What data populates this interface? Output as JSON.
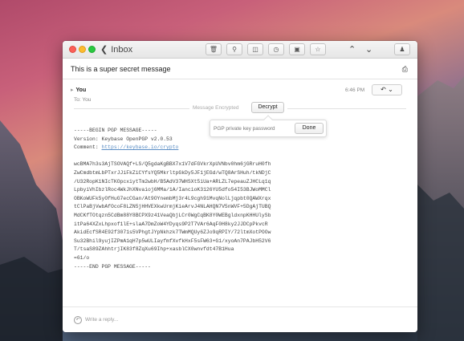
{
  "toolbar": {
    "back_label": "Inbox",
    "buttons": [
      "trash-icon",
      "tag-icon",
      "archive-icon",
      "clock-icon",
      "move-icon",
      "star-icon"
    ]
  },
  "message": {
    "subject": "This is a super secret message",
    "sender": "You",
    "to": "To: You",
    "time": "6:46 PM"
  },
  "encryption": {
    "status_label": "Message Encrypted",
    "decrypt_label": "Decrypt",
    "password_placeholder": "PGP private key password",
    "done_label": "Done"
  },
  "pgp": {
    "begin": "-----BEGIN PGP MESSAGE-----",
    "version": "Version: Keybase OpenPGP v2.0.53",
    "comment_prefix": "Comment: ",
    "comment_link": "https://keybase.io/crypto",
    "lines": [
      "wcBMA7h3s3AjTSOVAQf+LS/Q5gdaKgBBX7x1V7dFGVkrXpUVNbv0hm6jGRruH0fh",
      "ZwCmdbtmLbPTxrJJiFkZiCYfsYQ5MkrltpGkDy5JF1jEGd/wTQ8ArSHuh/tkNDjC",
      "/U32RopK1NIcTKOpcxiytTm2wbH/B5AdV37WHSXt5iUa+ARLZL7epeauZJHCLq1q",
      "LpbyiVhIbzlRoc4WkJhXNvaioj6MMa/1A/IancioK3126YU5dfo54I53BJWoMMCl",
      "OBKoWUFk5yOfHuG7ecCGan/At9OYnembMj3r4L9cgh91MvqNolLjqpbt0QAWXrqx",
      "tClPaBjVwbAfOcoF8LZN5jHHVEXkwUrmjKieArvJ4NLAHQN7V5nWVF+5DgAjTUBQ",
      "MdCKfTOtqzn5CdBm88Y8BCPX9z41VeaQbjLCr0WgCqBK8Y0WEBgldxnpKHHUlySb",
      "itPa64XZxLhpxof1lE+slaA7DmZoW4YDyqs9P2T7VAr6AqF0H8ky2JJDCpPkvcR",
      "AkidEcfSR4E92f3071s5VPhgtJYpNkhzk7TWmMQUy6ZJo9qRPIY/72ltmXotPOOw",
      "Su32Bhil9yujIZPmA1qH7p5wULIayfmfXvfkHxF5sFW63+G1/xyoAn7PAJbH52V6",
      "T/tsaS89ZAhhtrjIK83f8ZqXu69Ihp+xasblCX0wnvfdt47B1Hua",
      "=61/o"
    ],
    "end": "-----END PGP MESSAGE-----"
  },
  "reply": {
    "placeholder": "Write a reply..."
  }
}
